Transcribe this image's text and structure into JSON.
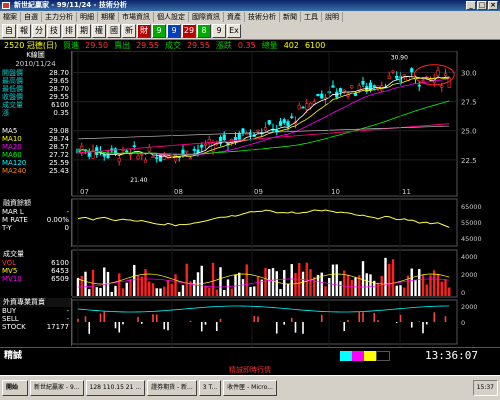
{
  "window": {
    "title": "新世紀贏家 - 99/11/24 - 技術分析"
  },
  "menu": [
    "檔案",
    "自選",
    "主力分析",
    "明細",
    "期權",
    "市場資訊",
    "個人設定",
    "國際資訊",
    "資產",
    "技術分析",
    "新聞",
    "工具",
    "說明"
  ],
  "toolbar": {
    "buttons": [
      "自",
      "報",
      "分",
      "技",
      "排",
      "期",
      "權",
      "國",
      "新",
      "財",
      "9",
      "9",
      "29",
      "8",
      "9",
      "Ex"
    ]
  },
  "quote": {
    "code_name": "2520 冠德(日)",
    "chg_label": "買進",
    "buy": "29.50",
    "buy_label": "賣出",
    "sell": "29.55",
    "sell_label": "成交",
    "last": "29.55",
    "change": "0.35",
    "change_label": "漲跌",
    "vol_label": "總量",
    "total_vol": "402",
    "extra": "6100"
  },
  "left_info": {
    "header": "K線圖",
    "date": "2010/11/24",
    "rows": [
      {
        "k": "開盤價",
        "v": "28.70"
      },
      {
        "k": "最高價",
        "v": "29.65"
      },
      {
        "k": "最低價",
        "v": "28.70"
      },
      {
        "k": "收盤價",
        "v": "29.55"
      },
      {
        "k": "成交量",
        "v": "6100"
      },
      {
        "k": "漲",
        "v": "0.35"
      }
    ],
    "ma": [
      {
        "k": "MA5",
        "v": "29.08"
      },
      {
        "k": "MA10",
        "v": "28.74"
      },
      {
        "k": "MA20",
        "v": "28.57"
      },
      {
        "k": "MA60",
        "v": "27.72"
      },
      {
        "k": "MA120",
        "v": "25.59"
      },
      {
        "k": "MA240",
        "v": "25.43"
      }
    ],
    "margin_header": "融資餘額",
    "margin_rows": [
      {
        "k": "MAR L",
        "v": "-"
      },
      {
        "k": "M RATE",
        "v": "0.00%"
      },
      {
        "k": "T-Y",
        "v": "0"
      }
    ],
    "vol_header": "成交量",
    "vol_rows": [
      {
        "k": "VOL",
        "v": "6100"
      },
      {
        "k": "MV5",
        "v": "6453"
      },
      {
        "k": "MV10",
        "v": "6509"
      }
    ],
    "foreign_header": "外資專業買賣",
    "foreign_rows": [
      {
        "k": "BUY",
        "v": "-"
      },
      {
        "k": "SELL",
        "v": "-"
      },
      {
        "k": "STOCK",
        "v": "17177"
      }
    ]
  },
  "chart": {
    "xticks": [
      "07",
      "08",
      "09",
      "10",
      "11"
    ],
    "price_ticks": [
      "30.0",
      "27.5",
      "25.0",
      "22.5"
    ],
    "high_label": "30.90",
    "low_label": "21.40",
    "margin_ticks": [
      "65000",
      "55000",
      "45000"
    ],
    "vol_ticks": [
      "4000",
      "2000",
      "0"
    ],
    "foreign_ticks": [
      "2000",
      "0"
    ]
  },
  "status": {
    "label": "精誠",
    "time": "13:36:07"
  },
  "redstatus": "精誠即時行情",
  "taskbar": [
    "開始",
    "新世紀贏家 - 9...",
    "128 110.15 21 ...",
    "證券期貨 - 新...",
    "3 T...",
    "收件匣 - Micro...",
    "15:37"
  ],
  "colors": {
    "up": "#ff3030",
    "down": "#00ffff",
    "ma5": "#ffffff",
    "ma10": "#ffff00",
    "ma20": "#ff00ff",
    "ma60": "#00ff00"
  }
}
